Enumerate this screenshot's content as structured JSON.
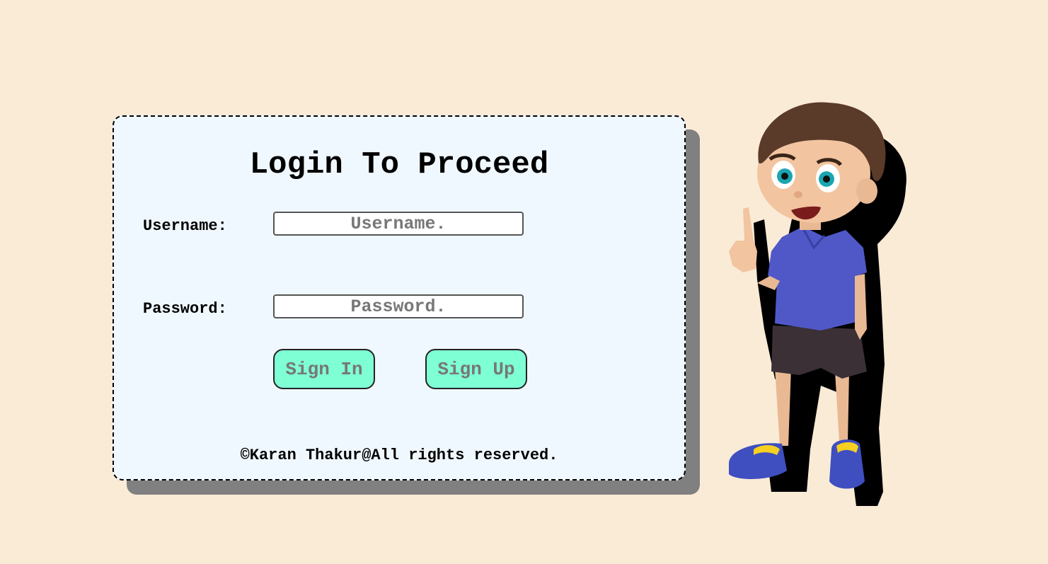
{
  "login": {
    "title": "Login To Proceed",
    "username_label": "Username:",
    "username_placeholder": "Username.",
    "password_label": "Password:",
    "password_placeholder": "Password.",
    "sign_in_label": "Sign In",
    "sign_up_label": "Sign Up",
    "footer": "©Karan Thakur@All rights reserved."
  },
  "colors": {
    "page_background": "#faebd7",
    "card_background": "#f0f8ff",
    "card_shadow": "#808080",
    "button_background": "#7fffd4",
    "button_text": "#777777",
    "shirt": "#5058c8",
    "shorts": "#3a3035",
    "hair": "#5a3a28",
    "skin": "#f2c4a0",
    "shoes": "#3f4fc0",
    "shoe_accent": "#f5d020"
  },
  "illustration": {
    "icon": "cartoon-boy-illustration"
  }
}
